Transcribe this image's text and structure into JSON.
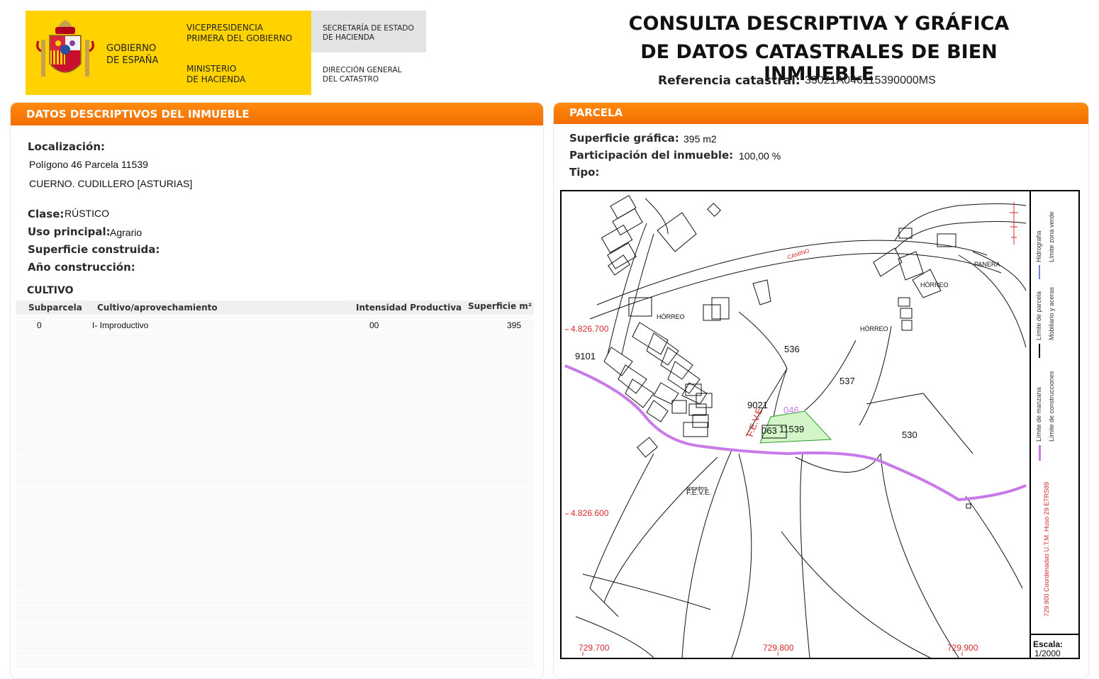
{
  "header": {
    "gov_name": "GOBIERNO\nDE ESPAÑA",
    "vice_presidency": "VICEPRESIDENCIA\nPRIMERA DEL GOBIERNO",
    "ministry": "MINISTERIO\nDE HACIENDA",
    "secretary": "SECRETARÍA DE ESTADO\nDE HACIENDA",
    "directorate": "DIRECCIÓN GENERAL\nDEL CATASTRO",
    "title_line1": "CONSULTA DESCRIPTIVA Y GRÁFICA",
    "title_line2": "DE DATOS CATASTRALES DE BIEN INMUEBLE",
    "ref_label": "Referencia catastral:",
    "ref_value": "33021A046115390000MS",
    "brand_color": "#ffd200"
  },
  "descriptive": {
    "heading": "DATOS DESCRIPTIVOS DEL INMUEBLE",
    "location_label": "Localización:",
    "location_line1": "Polígono 46 Parcela 11539",
    "location_line2": "CUERNO. CUDILLERO [ASTURIAS]",
    "class_label": "Clase:",
    "class_value": "RÚSTICO",
    "use_label": "Uso principal:",
    "use_value": "Agrario",
    "built_area_label": "Superficie construida:",
    "year_label": "Año construcción:",
    "accent_color": "#ff7b00"
  },
  "cultivo": {
    "heading": "CULTIVO",
    "columns": [
      "Subparcela",
      "Cultivo/aprovechamiento",
      "Intensidad Productiva",
      "Superficie m²"
    ],
    "rows": [
      [
        "0",
        "I- Improductivo",
        "00",
        "395"
      ]
    ]
  },
  "parcela": {
    "heading": "PARCELA",
    "surface_label": "Superficie gráfica:",
    "surface_value": "395 m2",
    "participation_label": "Participación del inmueble:",
    "participation_value": "100,00 %",
    "type_label": "Tipo:"
  },
  "map": {
    "labels": {
      "camino": "CAMINO",
      "panera": "PANERA",
      "horreo1": "HÓRREO",
      "horreo2": "HÓRREO",
      "horreo3": "HÓRREO",
      "n9101": "9101",
      "n536": "536",
      "n537": "537",
      "n530": "530",
      "n9021": "9021",
      "n046": "046",
      "n063": "063",
      "n11539": "11539",
      "feve_track": "F.E.V.E.",
      "feve_station": "F.E.V.E.",
      "apeadero": "apeadero",
      "coord_y1": "4.826.700",
      "coord_y2": "4.826.600",
      "coord_x1": "729.700",
      "coord_x2": "729.800",
      "coord_x3": "729.900"
    },
    "legend": {
      "utm": "729.900 Coordenadas U.T.M. Huso 29 ETRS89",
      "manzana": "Límite de manzana",
      "construcciones": "Límite de construcciones",
      "parcela": "Límite de parcela",
      "mobiliario": "Mobiliario y aceras",
      "hidrografia": "Hidrografía",
      "zona_verde": "Límite zona verde"
    },
    "scale_label": "Escala:",
    "scale_value": "1/2000",
    "colors": {
      "parcel_fill": "#d4f5c8",
      "parcel_stroke": "#2e9c2e",
      "block_line": "#c77ae8",
      "coords_text": "#d62c2c"
    }
  }
}
